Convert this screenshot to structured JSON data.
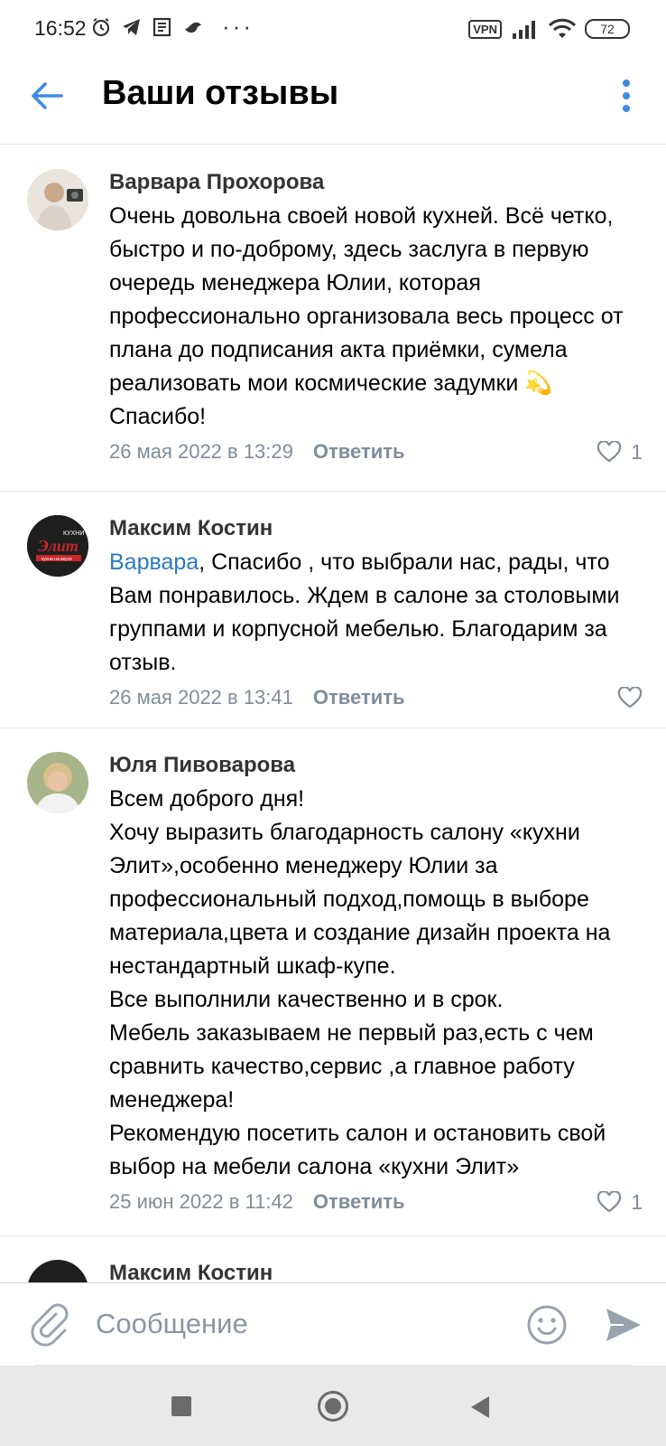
{
  "status_bar": {
    "time": "16:52",
    "vpn": "VPN",
    "battery": "72",
    "overflow": "···"
  },
  "header": {
    "title": "Ваши отзывы"
  },
  "comments": [
    {
      "author": "Варвара Прохорова",
      "text": "Очень довольна своей новой кухней. Всё четко, быстро и по-доброму, здесь заслуга в первую очередь менеджера Юлии, которая профессионально организовала весь процесс от плана до подписания акта приёмки, сумела реализовать мои космические задумки 💫 Спасибо!",
      "date": "26 мая 2022 в 13:29",
      "reply": "Ответить",
      "likes": "1"
    },
    {
      "author": "Максим Костин",
      "mention": "Варвара",
      "text": ", Спасибо , что выбрали нас, рады, что Вам понравилось. Ждем в салоне за столовыми группами и корпусной мебелью. Благодарим за отзыв.",
      "date": "26 мая 2022 в 13:41",
      "reply": "Ответить",
      "avatar_brand_top": "КУХНИ",
      "avatar_brand": "Элит",
      "avatar_brand_sub": "кухни на вкусе"
    },
    {
      "author": "Юля Пивоварова",
      "text": "Всем доброго дня!\nХочу выразить благодарность салону «кухни Элит»,особенно менеджеру Юлии за профессиональный подход,помощь в выборе материала,цвета и создание дизайн проекта на нестандартный шкаф-купе.\nВсе выполнили качественно и в срок.\nМебель заказываем не первый раз,есть с чем сравнить качество,сервис ,а главное работу менеджера!\nРекомендую посетить салон и остановить свой выбор на мебели салона «кухни Элит»",
      "date": "25 июн 2022 в 11:42",
      "reply": "Ответить",
      "likes": "1"
    },
    {
      "author": "Максим Костин"
    }
  ],
  "composer": {
    "placeholder": "Сообщение"
  },
  "colors": {
    "accent": "#2a7ac0",
    "secondary_text": "#818c99",
    "divider": "#e4e6ea"
  },
  "icons": [
    "alarm-icon",
    "telegram-icon",
    "news-icon",
    "bird-icon",
    "signal-icon",
    "wifi-icon",
    "back-arrow-icon",
    "more-vertical-icon",
    "heart-icon",
    "paperclip-icon",
    "smile-icon",
    "send-icon"
  ]
}
